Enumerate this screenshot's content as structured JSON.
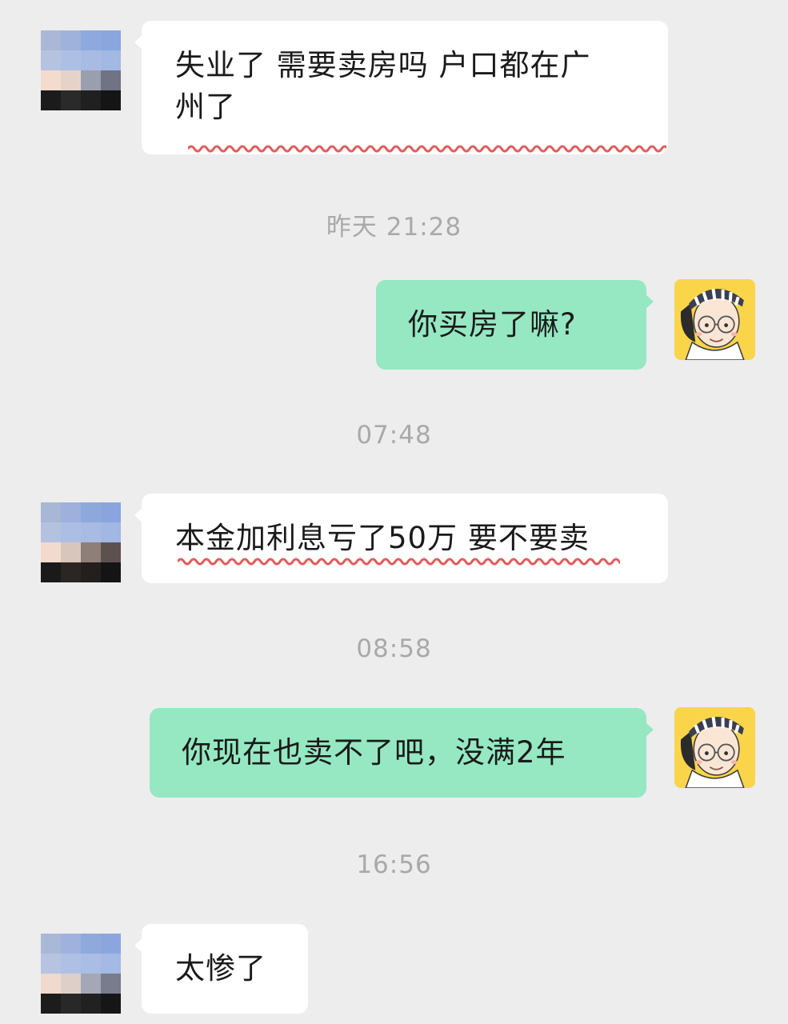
{
  "theme": {
    "background": "#ededed",
    "incoming_bubble": "#ffffff",
    "outgoing_bubble": "#95e8c2",
    "underline": "#e35b5b",
    "timestamp": "#a9a9a9"
  },
  "avatars": {
    "contact": "pixelated-avatar",
    "me": "cartoon-glasses-avatar"
  },
  "messages": [
    {
      "side": "in",
      "text": "失业了 需要卖房吗 户口都在广\n州了"
    },
    {
      "side": "time",
      "text": "昨天 21:28"
    },
    {
      "side": "out",
      "text": "你买房了嘛?"
    },
    {
      "side": "time",
      "text": "07:48"
    },
    {
      "side": "in",
      "text": "本金加利息亏了50万 要不要卖"
    },
    {
      "side": "time",
      "text": "08:58"
    },
    {
      "side": "out",
      "text": "你现在也卖不了吧，没满2年"
    },
    {
      "side": "time",
      "text": "16:56"
    },
    {
      "side": "in",
      "text": "太惨了"
    }
  ]
}
